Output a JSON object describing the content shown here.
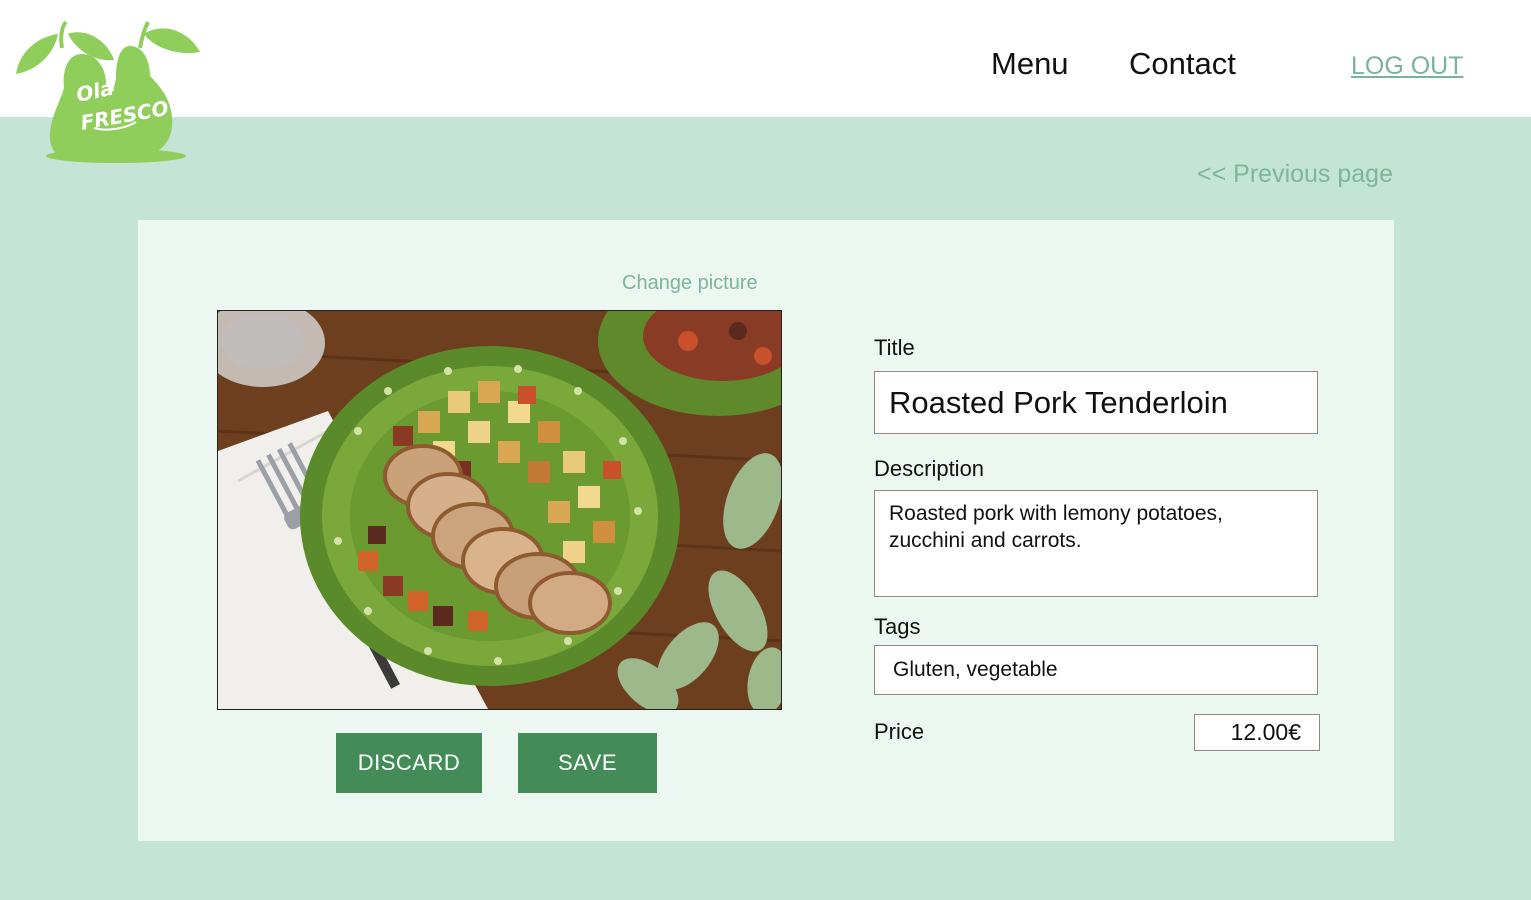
{
  "header": {
    "logo_text_top": "Ola",
    "logo_text_bottom": "FRESCO",
    "nav": [
      {
        "label": "Menu"
      },
      {
        "label": "Contact"
      }
    ],
    "logout_label": "LOG OUT"
  },
  "previous_page_label": "<< Previous page",
  "editor": {
    "change_picture_label": "Change picture",
    "discard_label": "DISCARD",
    "save_label": "SAVE",
    "title_label": "Title",
    "title_value": "Roasted Pork Tenderloin",
    "description_label": "Description",
    "description_value": "Roasted pork with lemony potatoes, zucchini and carrots.",
    "tags_label": "Tags",
    "tags_value": "Gluten, vegetable",
    "price_label": "Price",
    "price_value": "12.00€"
  },
  "colors": {
    "background": "#c4e5d6",
    "card": "#edf7f2",
    "accent": "#438b57",
    "link": "#7fb59b",
    "logo_green": "#8fce5a"
  },
  "icons": [
    "pear-logo-icon"
  ]
}
